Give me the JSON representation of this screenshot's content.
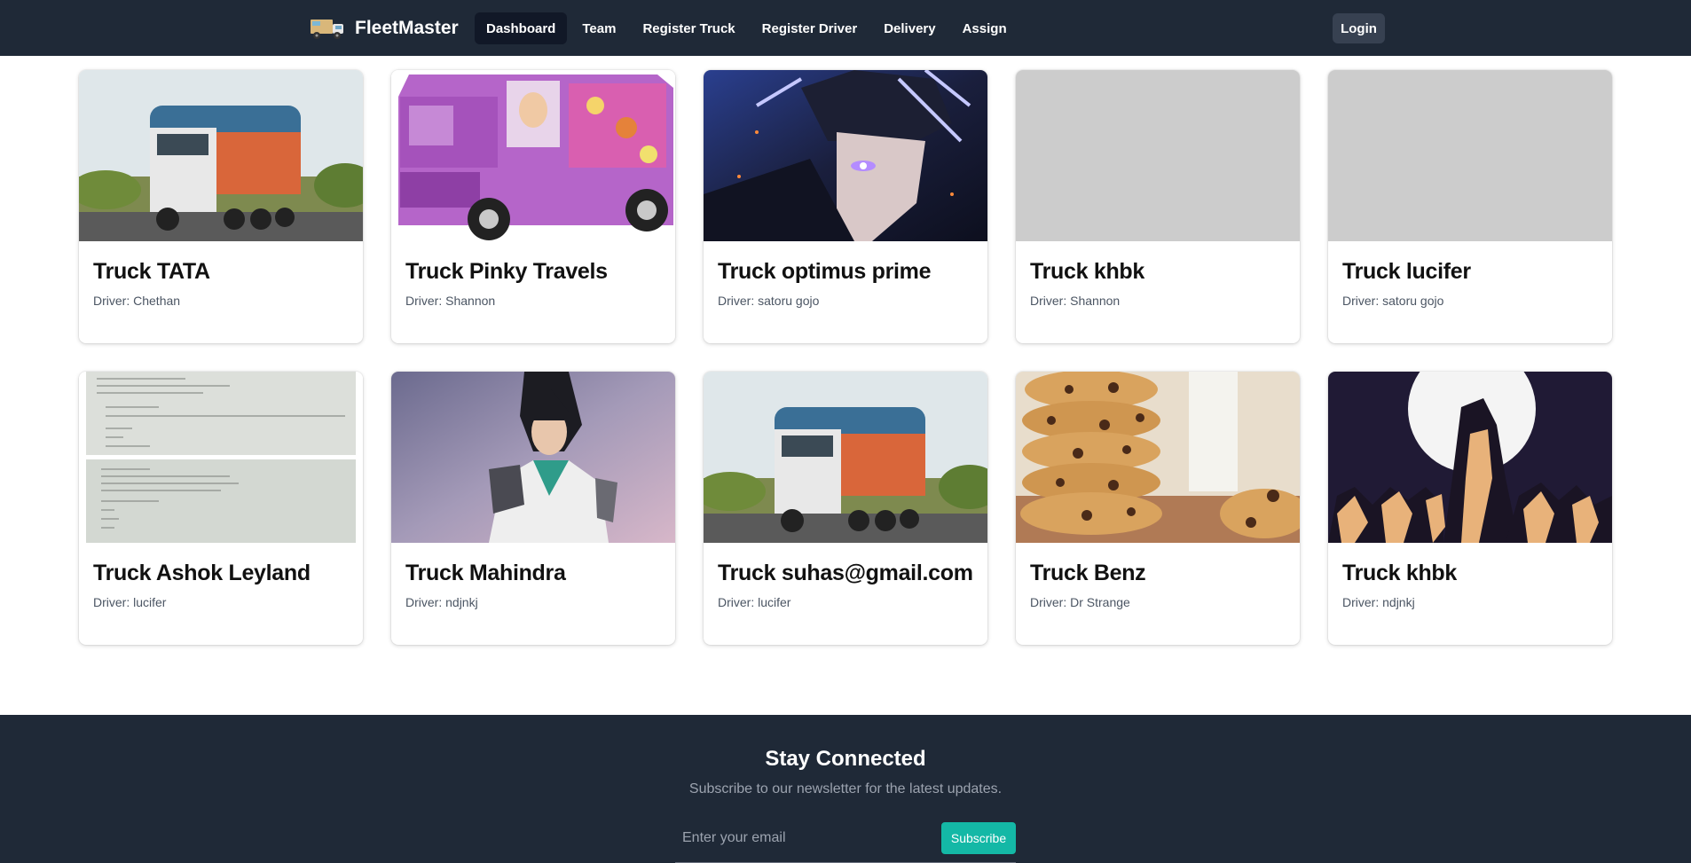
{
  "nav": {
    "brand": "FleetMaster",
    "links": [
      {
        "label": "Dashboard",
        "active": true
      },
      {
        "label": "Team"
      },
      {
        "label": "Register Truck"
      },
      {
        "label": "Register Driver"
      },
      {
        "label": "Delivery"
      },
      {
        "label": "Assign"
      }
    ],
    "login": "Login"
  },
  "driver_prefix": "Driver:",
  "trucks": [
    {
      "title": "Truck TATA",
      "driver": "Chethan",
      "image": "truck-photo"
    },
    {
      "title": "Truck Pinky Travels",
      "driver": "Shannon",
      "image": "barbie-van"
    },
    {
      "title": "Truck optimus prime",
      "driver": "satoru gojo",
      "image": "anime-character"
    },
    {
      "title": "Truck khbk",
      "driver": "Shannon",
      "image": "placeholder"
    },
    {
      "title": "Truck lucifer",
      "driver": "satoru gojo",
      "image": "placeholder"
    },
    {
      "title": "Truck Ashok Leyland",
      "driver": "lucifer",
      "image": "paper-notes"
    },
    {
      "title": "Truck Mahindra",
      "driver": "ndjnkj",
      "image": "game-character"
    },
    {
      "title": "Truck suhas@gmail.com",
      "driver": "lucifer",
      "image": "truck-photo"
    },
    {
      "title": "Truck Benz",
      "driver": "Dr Strange",
      "image": "cookies"
    },
    {
      "title": "Truck khbk",
      "driver": "ndjnkj",
      "image": "moon-silhouettes"
    }
  ],
  "footer": {
    "title": "Stay Connected",
    "subtitle": "Subscribe to our newsletter for the latest updates.",
    "email_placeholder": "Enter your email",
    "subscribe": "Subscribe"
  },
  "colors": {
    "nav_bg": "#1f2937",
    "accent": "#14b8a6",
    "placeholder_gray": "#cccccc"
  }
}
